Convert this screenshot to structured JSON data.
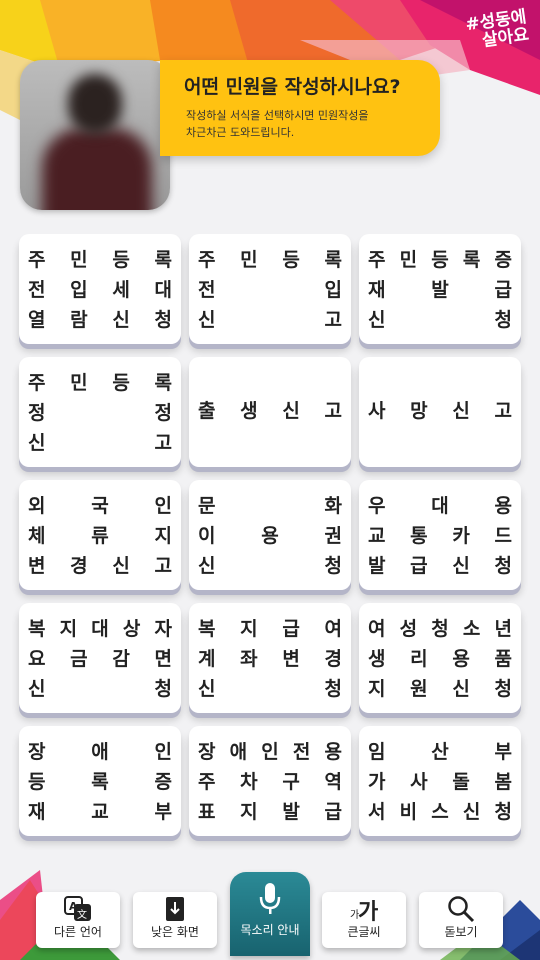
{
  "brand": {
    "line1": "#성동에",
    "line2": "살아요"
  },
  "header": {
    "title": "어떤 민원을 작성하시나요?",
    "subtitle_line1": "작성하실 서식을 선택하시면 민원작성을",
    "subtitle_line2": "차근차근 도와드립니다."
  },
  "forms": [
    {
      "lines": [
        "주민등록",
        "전입세대",
        "열람신청"
      ]
    },
    {
      "lines": [
        "주민등록",
        "전입",
        "신고"
      ]
    },
    {
      "lines": [
        "주민등록증",
        "재발급",
        "신청"
      ]
    },
    {
      "lines": [
        "주민등록",
        "정정",
        "신고"
      ]
    },
    {
      "lines": [
        "출생신고"
      ]
    },
    {
      "lines": [
        "사망신고"
      ]
    },
    {
      "lines": [
        "외국인",
        "체류지",
        "변경신고"
      ]
    },
    {
      "lines": [
        "문화",
        "이용권",
        "신청"
      ]
    },
    {
      "lines": [
        "우대용",
        "교통카드",
        "발급신청"
      ]
    },
    {
      "lines": [
        "복지대상자",
        "요금감면",
        "신청"
      ]
    },
    {
      "lines": [
        "복지급여",
        "계좌변경",
        "신청"
      ]
    },
    {
      "lines": [
        "여성청소년",
        "생리용품",
        "지원신청"
      ]
    },
    {
      "lines": [
        "장애인",
        "등록증",
        "재교부"
      ]
    },
    {
      "lines": [
        "장애인전용",
        "주차구역",
        "표지발급"
      ]
    },
    {
      "lines": [
        "임산부",
        "가사돌봄",
        "서비스신청"
      ]
    }
  ],
  "bottom_nav": {
    "language": "다른 언어",
    "low_screen": "낮은 화면",
    "voice": "목소리 안내",
    "large_font": "큰글씨",
    "magnifier": "돋보기"
  },
  "colors": {
    "accent": "#ffc211",
    "voice": "#1f7480",
    "button_shadow": "#b4b5c8"
  }
}
